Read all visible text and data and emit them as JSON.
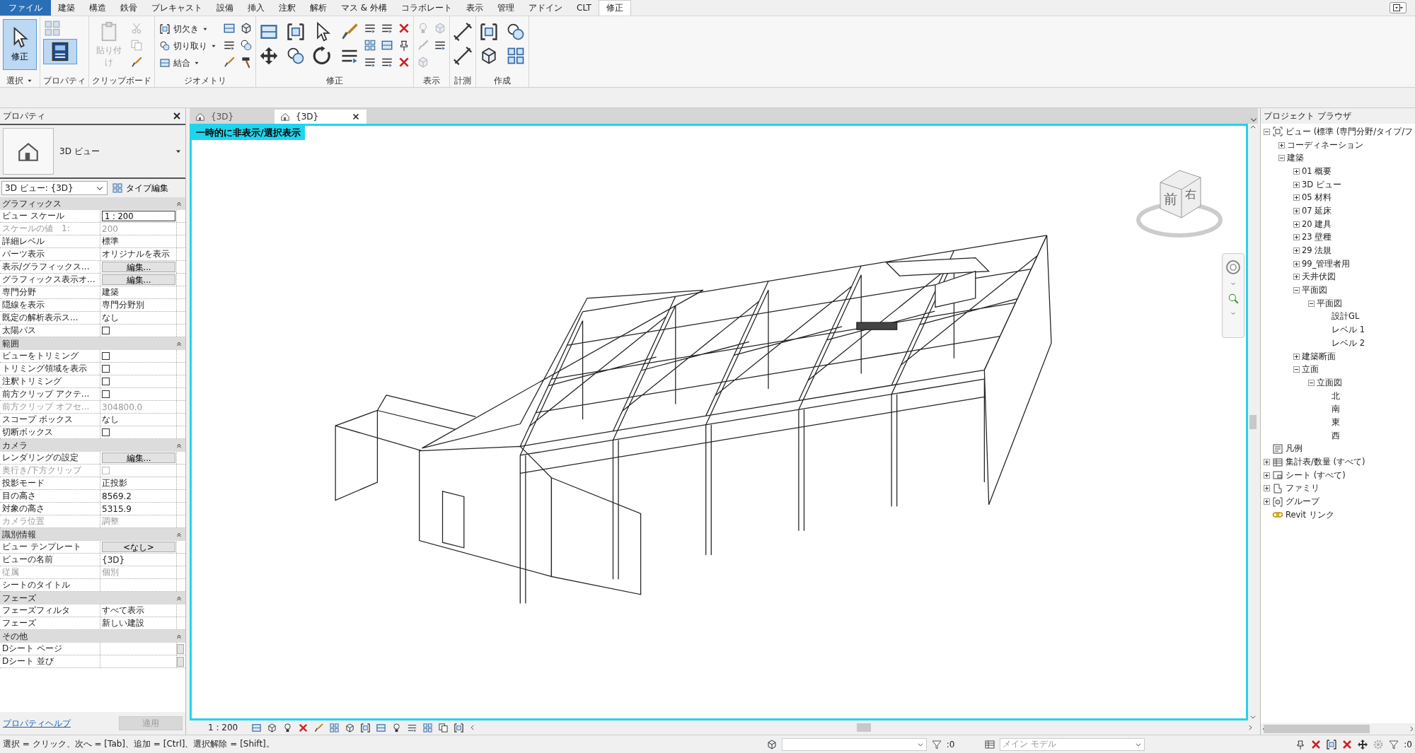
{
  "menu_tabs": [
    {
      "label": "ファイル",
      "kind": "file",
      "selected": false
    },
    {
      "label": "建築",
      "kind": "tab",
      "selected": false
    },
    {
      "label": "構造",
      "kind": "tab",
      "selected": false
    },
    {
      "label": "鉄骨",
      "kind": "tab",
      "selected": false
    },
    {
      "label": "プレキャスト",
      "kind": "tab",
      "selected": false
    },
    {
      "label": "設備",
      "kind": "tab",
      "selected": false
    },
    {
      "label": "挿入",
      "kind": "tab",
      "selected": false
    },
    {
      "label": "注釈",
      "kind": "tab",
      "selected": false
    },
    {
      "label": "解析",
      "kind": "tab",
      "selected": false
    },
    {
      "label": "マス & 外構",
      "kind": "tab",
      "selected": false
    },
    {
      "label": "コラボレート",
      "kind": "tab",
      "selected": false
    },
    {
      "label": "表示",
      "kind": "tab",
      "selected": false
    },
    {
      "label": "管理",
      "kind": "tab",
      "selected": false
    },
    {
      "label": "アドイン",
      "kind": "tab",
      "selected": false
    },
    {
      "label": "CLT",
      "kind": "tab",
      "selected": false
    },
    {
      "label": "修正",
      "kind": "tab",
      "selected": true
    }
  ],
  "ribbon": {
    "panels": [
      {
        "title": "選択",
        "has_menu": true,
        "tools": [
          {
            "kind": "large",
            "label": "修正",
            "selected": true,
            "disabled": false
          }
        ]
      },
      {
        "title": "プロパティ",
        "tools": [
          {
            "kind": "large_icon",
            "selected": true,
            "disabled": false
          }
        ]
      },
      {
        "title": "クリップボード",
        "tools": [
          {
            "kind": "large",
            "label": "貼り付け",
            "selected": false,
            "disabled": true
          }
        ]
      },
      {
        "title": "ジオメトリ",
        "tools": [
          {
            "kind": "small",
            "label": "切欠き",
            "disabled": false
          },
          {
            "kind": "small",
            "label": "切り取り",
            "disabled": false
          },
          {
            "kind": "small",
            "label": "結合",
            "disabled": false
          }
        ]
      },
      {
        "title": "修正"
      },
      {
        "title": "表示"
      },
      {
        "title": "計測"
      },
      {
        "title": "作成"
      }
    ]
  },
  "properties": {
    "title": "プロパティ",
    "type_name": "3D ビュー",
    "type_selector": "3D ビュー: {3D}",
    "edit_type": "タイプ編集",
    "groups": [
      {
        "name": "グラフィックス",
        "expanded": true,
        "rows": [
          {
            "label": "ビュー スケール",
            "kind": "input",
            "value": "1 : 200",
            "disabled": false
          },
          {
            "label": "スケールの値　1:",
            "kind": "text",
            "value": "200",
            "disabled": true
          },
          {
            "label": "詳細レベル",
            "kind": "text",
            "value": "標準",
            "disabled": false
          },
          {
            "label": "パーツ表示",
            "kind": "text",
            "value": "オリジナルを表示",
            "disabled": false
          },
          {
            "label": "表示/グラフィックス...",
            "kind": "button",
            "value": "編集...",
            "disabled": false
          },
          {
            "label": "グラフィックス表示オ...",
            "kind": "button",
            "value": "編集...",
            "disabled": false
          },
          {
            "label": "専門分野",
            "kind": "text",
            "value": "建築",
            "disabled": false
          },
          {
            "label": "隠線を表示",
            "kind": "text",
            "value": "専門分野別",
            "disabled": false
          },
          {
            "label": "既定の解析表示ス...",
            "kind": "text",
            "value": "なし",
            "disabled": false
          },
          {
            "label": "太陽パス",
            "kind": "checkbox",
            "checked": false,
            "disabled": false
          }
        ]
      },
      {
        "name": "範囲",
        "expanded": true,
        "rows": [
          {
            "label": "ビューをトリミング",
            "kind": "checkbox",
            "checked": false,
            "disabled": false
          },
          {
            "label": "トリミング領域を表示",
            "kind": "checkbox",
            "checked": false,
            "disabled": false
          },
          {
            "label": "注釈トリミング",
            "kind": "checkbox",
            "checked": false,
            "disabled": false
          },
          {
            "label": "前方クリップ アクテ...",
            "kind": "checkbox",
            "checked": false,
            "disabled": false
          },
          {
            "label": "前方クリップ オフセ...",
            "kind": "text",
            "value": "304800.0",
            "disabled": true
          },
          {
            "label": "スコープ ボックス",
            "kind": "text",
            "value": "なし",
            "disabled": false
          },
          {
            "label": "切断ボックス",
            "kind": "checkbox",
            "checked": false,
            "disabled": false
          }
        ]
      },
      {
        "name": "カメラ",
        "expanded": true,
        "rows": [
          {
            "label": "レンダリングの設定",
            "kind": "button",
            "value": "編集...",
            "disabled": false
          },
          {
            "label": "奥行き/下方クリップ",
            "kind": "checkbox",
            "checked": false,
            "disabled": true
          },
          {
            "label": "投影モード",
            "kind": "text",
            "value": "正投影",
            "disabled": false
          },
          {
            "label": "目の高さ",
            "kind": "text",
            "value": "8569.2",
            "disabled": false
          },
          {
            "label": "対象の高さ",
            "kind": "text",
            "value": "5315.9",
            "disabled": false
          },
          {
            "label": "カメラ位置",
            "kind": "text",
            "value": "調整",
            "disabled": true
          }
        ]
      },
      {
        "name": "識別情報",
        "expanded": true,
        "rows": [
          {
            "label": "ビュー テンプレート",
            "kind": "button",
            "value": "<なし>",
            "disabled": false
          },
          {
            "label": "ビューの名前",
            "kind": "text",
            "value": "{3D}",
            "disabled": false
          },
          {
            "label": "従属",
            "kind": "text",
            "value": "個別",
            "disabled": true
          },
          {
            "label": "シートのタイトル",
            "kind": "text",
            "disabled": false
          }
        ]
      },
      {
        "name": "フェーズ",
        "expanded": true,
        "rows": [
          {
            "label": "フェーズフィルタ",
            "kind": "text",
            "value": "すべて表示",
            "disabled": false
          },
          {
            "label": "フェーズ",
            "kind": "text",
            "value": "新しい建設",
            "disabled": false
          }
        ]
      },
      {
        "name": "その他",
        "expanded": true,
        "rows": [
          {
            "label": "Dシート ページ",
            "kind": "browse",
            "disabled": false
          },
          {
            "label": "Dシート 並び",
            "kind": "browse",
            "disabled": false
          }
        ]
      }
    ],
    "help_link": "プロパティヘルプ",
    "apply": "適用",
    "apply_disabled": true
  },
  "view_tabs": [
    {
      "label": "{3D}",
      "selected": false
    },
    {
      "label": "{3D}",
      "selected": true
    }
  ],
  "viewport": {
    "banner": "一時的に非表示/選択表示",
    "viewcube": {
      "front": "前",
      "right": "右"
    }
  },
  "view_control_bar": {
    "scale": "1 : 200"
  },
  "browser": {
    "title": "プロジェクト ブラウザ",
    "tree": [
      {
        "label": "ビュー (標準 (専門分野/タイプ/フ",
        "kind": "views",
        "expanded": true,
        "children": [
          {
            "label": "コーディネーション",
            "expanded": false
          },
          {
            "label": "建築",
            "expanded": true,
            "children": [
              {
                "label": "01 概要",
                "expanded": false
              },
              {
                "label": "3D ビュー",
                "expanded": false
              },
              {
                "label": "05 材料",
                "expanded": false
              },
              {
                "label": "07 延床",
                "expanded": false
              },
              {
                "label": "20 建具",
                "expanded": false
              },
              {
                "label": "23 壁種",
                "expanded": false
              },
              {
                "label": "29 法規",
                "expanded": false
              },
              {
                "label": "99_管理者用",
                "expanded": false
              },
              {
                "label": "天井伏図",
                "expanded": false
              },
              {
                "label": "平面図",
                "expanded": true,
                "children": [
                  {
                    "label": "平面図",
                    "expanded": true,
                    "children": [
                      {
                        "label": "設計GL"
                      },
                      {
                        "label": "レベル 1"
                      },
                      {
                        "label": "レベル 2"
                      }
                    ]
                  }
                ]
              },
              {
                "label": "建築断面",
                "expanded": false
              },
              {
                "label": "立面",
                "expanded": true,
                "children": [
                  {
                    "label": "立面図",
                    "expanded": true,
                    "children": [
                      {
                        "label": "北"
                      },
                      {
                        "label": "南"
                      },
                      {
                        "label": "東"
                      },
                      {
                        "label": "西"
                      }
                    ]
                  }
                ]
              }
            ]
          }
        ]
      },
      {
        "label": "凡例",
        "kind": "legends"
      },
      {
        "label": "集計表/数量 (すべて)",
        "kind": "schedules",
        "expanded": false
      },
      {
        "label": "シート (すべて)",
        "kind": "sheets",
        "expanded": false
      },
      {
        "label": "ファミリ",
        "kind": "families",
        "expanded": false
      },
      {
        "label": "グループ",
        "kind": "groups",
        "expanded": false
      },
      {
        "label": "Revit リンク",
        "kind": "links"
      }
    ]
  },
  "status_bar": {
    "hint": "選択 = クリック、次へ = [Tab]、追加 = [Ctrl]、選択解除 = [Shift]。",
    "filter_count": ":0",
    "design_option": "メイン モデル",
    "selection_count": ":0"
  }
}
